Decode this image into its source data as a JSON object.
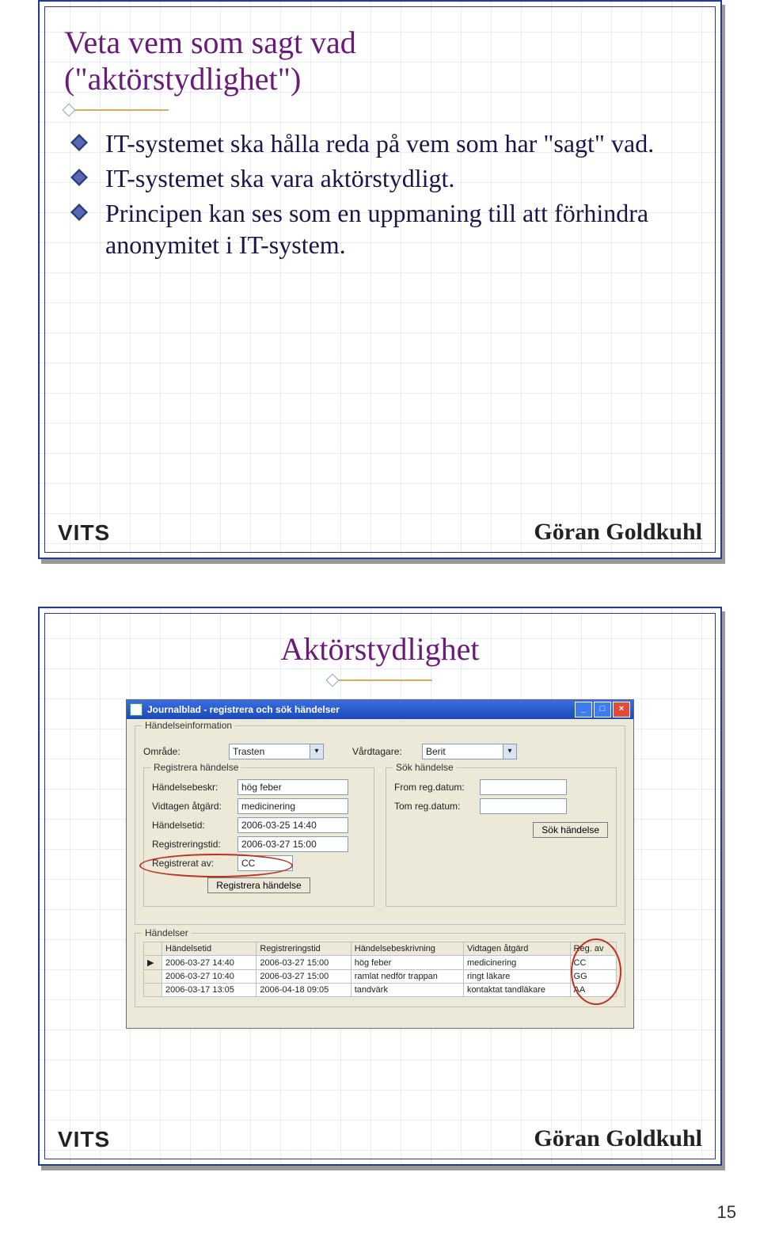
{
  "page_number": "15",
  "slide1": {
    "title_line1": "Veta vem som sagt vad",
    "title_line2": "(\"aktörstydlighet\")",
    "bullets": [
      "IT-systemet ska hålla reda på vem som har \"sagt\" vad.",
      "IT-systemet ska vara aktörstydligt.",
      "Principen kan ses som en uppmaning till att förhindra anonymitet i IT-system."
    ],
    "logo": "VITS",
    "author": "Göran Goldkuhl"
  },
  "slide2": {
    "title": "Aktörstydlighet",
    "logo": "VITS",
    "author": "Göran Goldkuhl",
    "app": {
      "window_title": "Journalblad - registrera och sök händelser",
      "section_info": "Händelseinformation",
      "omrade_label": "Område:",
      "omrade_value": "Trasten",
      "vardtagare_label": "Vårdtagare:",
      "vardtagare_value": "Berit",
      "reg_group": "Registrera händelse",
      "reg_fields": {
        "handelsebeskr_label": "Händelsebeskr:",
        "handelsebeskr_value": "hög feber",
        "vidtagen_label": "Vidtagen åtgärd:",
        "vidtagen_value": "medicinering",
        "handelsetid_label": "Händelsetid:",
        "handelsetid_value": "2006-03-25 14:40",
        "registreringstid_label": "Registreringstid:",
        "registreringstid_value": "2006-03-27 15:00",
        "registrerat_label": "Registrerat av:",
        "registrerat_value": "CC",
        "register_btn": "Registrera händelse"
      },
      "sok_group": "Sök händelse",
      "sok_fields": {
        "from_label": "From reg.datum:",
        "tom_label": "Tom reg.datum:",
        "sok_btn": "Sök händelse"
      },
      "events_group": "Händelser",
      "table": {
        "headers": [
          "",
          "Händelsetid",
          "Registreringstid",
          "Händelsebeskrivning",
          "Vidtagen åtgärd",
          "Reg. av"
        ],
        "rows": [
          [
            "▶",
            "2006-03-27 14:40",
            "2006-03-27 15:00",
            "hög feber",
            "medicinering",
            "CC"
          ],
          [
            "",
            "2006-03-27 10:40",
            "2006-03-27 15:00",
            "ramlat nedför trappan",
            "ringt läkare",
            "GG"
          ],
          [
            "",
            "2006-03-17 13:05",
            "2006-04-18 09:05",
            "tandvärk",
            "kontaktat tandläkare",
            "AA"
          ]
        ]
      }
    }
  }
}
